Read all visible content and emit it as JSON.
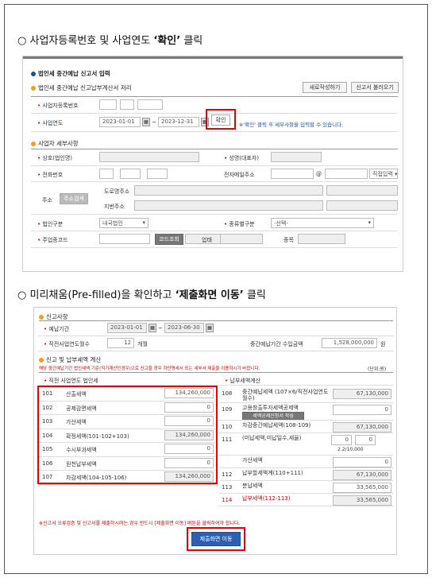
{
  "step1": {
    "circle": "○",
    "prefix": "사업자등록번호 및 사업연도 ",
    "emphasis": "‘확인’",
    "suffix": " 클릭"
  },
  "step2": {
    "circle": "○",
    "prefix": "미리채움(Pre-filled)을 확인하고 ",
    "emphasis": "‘제출화면 이동’",
    "suffix": " 클릭"
  },
  "screen1": {
    "title": "법인세 중간예납 신고서 입력",
    "subtitle": "법인세 중간예납 신고납부계산서 저리",
    "rewrite_btn": "새로작성하기",
    "load_btn": "신고서 불러오기",
    "bizno_label": "사업자등록번호",
    "year_label": "사업연도",
    "start_date": "2023-01-01",
    "tilde": "~",
    "end_date": "2023-12-31",
    "confirm_btn": "확인",
    "hint": "※'확인' 클릭 후 세부사항을 입력할 수 있습니다.",
    "taxpayer_section": "사업자 세부사항",
    "trade_name": "상호(법인명)",
    "rep_name": "성명(대표자)",
    "phone": "전화번호",
    "email": "전자메일주소",
    "at": "@",
    "email_select": "직접입력",
    "address": "주소",
    "address_btn": "주소검색",
    "road_addr": "도로명주소",
    "lot_addr": "지번주소",
    "corp_type": "법인구분",
    "corp_type_val": "내국법인",
    "kind": "종류별구분",
    "kind_val": "-선택-",
    "industry_code": "주업종코드",
    "code_btn": "코드조회",
    "business": "업태",
    "item": "종목"
  },
  "screen2": {
    "report_section": "신고사항",
    "prepay_period": "예납기간",
    "p_start": "2023-01-01",
    "tilde": "~",
    "p_end": "2023-06-30",
    "prev_months_label": "직전사업연도월수",
    "prev_months": "12",
    "month_unit": "개월",
    "period_income_label": "중간예납기간 수입금액",
    "period_income": "1,528,000,000",
    "won": "원",
    "calc_section": "신고 및 납부세액 계산",
    "note": "해당 중간예납기간 법인세액 기준(직기계산인경우)으로 신고할 경우 하단명세서 또는 세부서 제출을 이용하시기 바랍니다.",
    "unit": "(단위:원)",
    "left_header": "직전 사업연도 법인세",
    "right_header": "납부세액계산",
    "left_rows": [
      {
        "no": "101",
        "label": "산출세액",
        "value": "134,260,000"
      },
      {
        "no": "102",
        "label": "공제감면세액",
        "value": "0"
      },
      {
        "no": "103",
        "label": "가산세액",
        "value": "0"
      },
      {
        "no": "104",
        "label": "확정세액(101-102+103)",
        "value": "134,260,000"
      },
      {
        "no": "105",
        "label": "수시부과세액",
        "value": "0"
      },
      {
        "no": "106",
        "label": "원천납부세액",
        "value": "0"
      },
      {
        "no": "107",
        "label": "차감세액(104-105-106)",
        "value": "134,260,000"
      }
    ],
    "right_rows": [
      {
        "no": "108",
        "label": "중간예납세액 (107×6/직전사업연도월수)",
        "value": "67,130,000"
      },
      {
        "no": "109",
        "label": "고용창출투자세액공제액",
        "btn": "세액공제신청서 작성",
        "value": "0"
      },
      {
        "no": "110",
        "label": "차감중간예납세액(108-109)",
        "value": "67,130,000"
      },
      {
        "no": "111",
        "label": "(미납세액,미납일수,세율)",
        "value_a": "0",
        "value_b": "0",
        "rate": "2.2/10,000"
      },
      {
        "no": "",
        "label": "가산세액",
        "value": "0"
      },
      {
        "no": "112",
        "label": "납부할세액계(110+111)",
        "value": "67,130,000"
      },
      {
        "no": "113",
        "label": "분납세액",
        "value": "33,565,000"
      },
      {
        "no": "114",
        "label": "납부세액(112-113)",
        "value": "33,565,000"
      }
    ],
    "warning": "※신고서 오류검증 및 신고서를 제출하시려는 경우 반드시 [제출화면 이동] 버튼을 클릭하여야 합니다.",
    "submit_btn": "제출화면 이동"
  },
  "colors": {
    "accent_red": "#e00000",
    "brand_blue": "#1a4fa0",
    "orange_dot": "#f0a020"
  }
}
